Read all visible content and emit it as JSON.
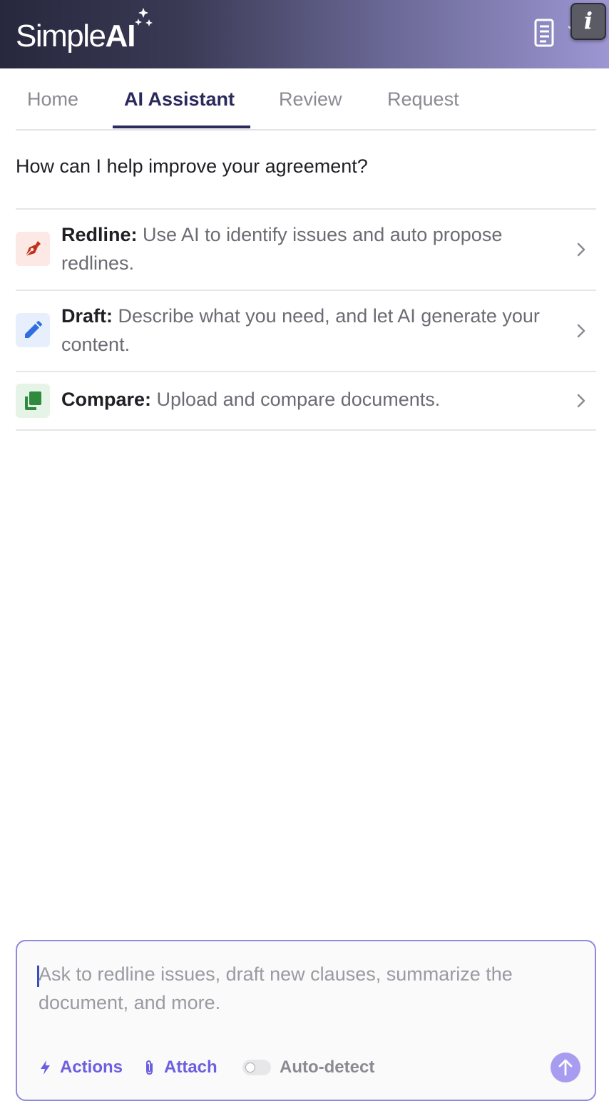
{
  "header": {
    "logo_text": "Simple",
    "logo_bold": "AI",
    "info_label": "i",
    "icons": [
      "sparkle-icon",
      "document-list-icon",
      "chevron-down-icon",
      "info-icon"
    ],
    "colors": {
      "gradient_start": "#27273d",
      "gradient_end": "#9c96d2"
    }
  },
  "tabs": [
    {
      "label": "Home",
      "active": false
    },
    {
      "label": "AI Assistant",
      "active": true
    },
    {
      "label": "Review",
      "active": false
    },
    {
      "label": "Request",
      "active": false
    }
  ],
  "prompt": "How can I help improve your agreement?",
  "options": [
    {
      "title": "Redline:",
      "description": "Use AI to identify issues and auto propose redlines.",
      "icon": "pen-nib-icon",
      "icon_color": "#c0311b",
      "icon_bg": "#fce8e4"
    },
    {
      "title": "Draft:",
      "description": "Describe what you need, and let AI generate your content.",
      "icon": "pencil-icon",
      "icon_color": "#2f6fe0",
      "icon_bg": "#e8effc"
    },
    {
      "title": "Compare:",
      "description": "Upload and compare documents.",
      "icon": "copy-documents-icon",
      "icon_color": "#2e8b3e",
      "icon_bg": "#e6f4e8"
    }
  ],
  "composer": {
    "placeholder": "Ask to redline issues, draft new clauses, summarize the document, and more.",
    "actions_label": "Actions",
    "attach_label": "Attach",
    "autodetect_label": "Auto-detect",
    "autodetect_on": false,
    "colors": {
      "accent": "#6b5fe0",
      "border": "#8f89dc",
      "send": "#a79cf0"
    }
  }
}
